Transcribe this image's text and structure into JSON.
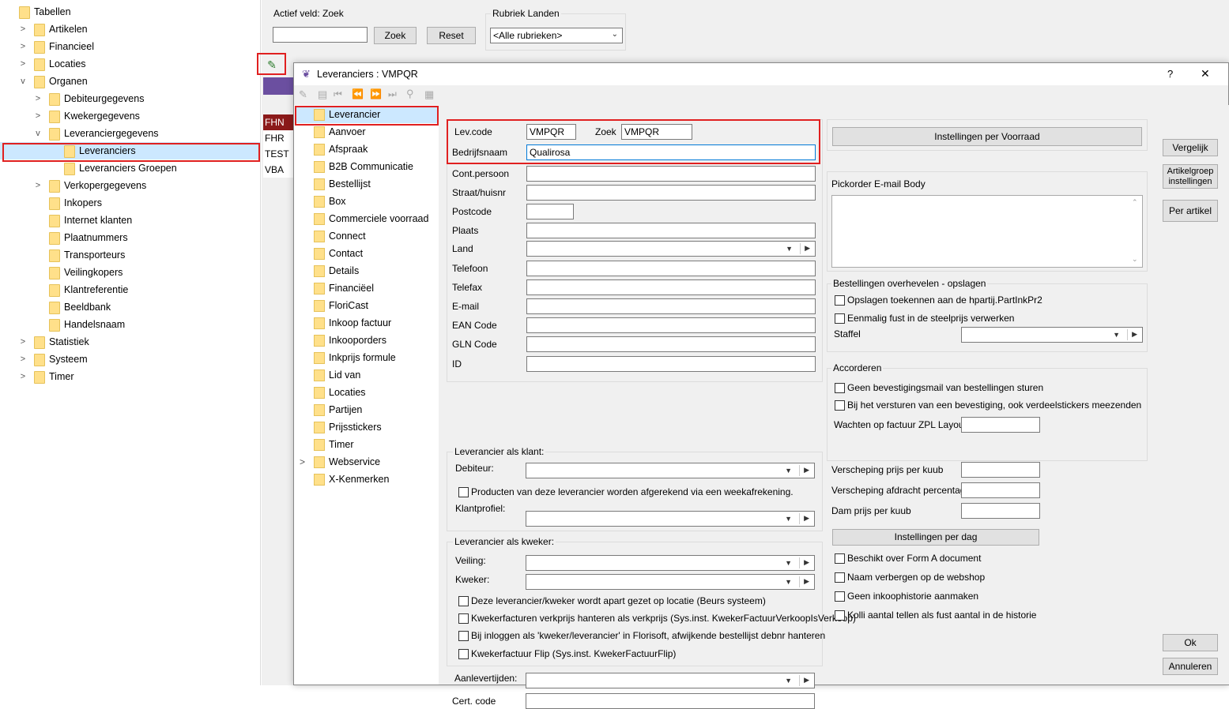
{
  "tree": {
    "items": [
      {
        "label": "Tabellen",
        "indent": 0,
        "chev": ""
      },
      {
        "label": "Artikelen",
        "indent": 1,
        "chev": ">"
      },
      {
        "label": "Financieel",
        "indent": 1,
        "chev": ">"
      },
      {
        "label": "Locaties",
        "indent": 1,
        "chev": ">"
      },
      {
        "label": "Organen",
        "indent": 1,
        "chev": "v"
      },
      {
        "label": "Debiteurgegevens",
        "indent": 2,
        "chev": ">"
      },
      {
        "label": "Kwekergegevens",
        "indent": 2,
        "chev": ">"
      },
      {
        "label": "Leveranciergegevens",
        "indent": 2,
        "chev": "v"
      },
      {
        "label": "Leveranciers",
        "indent": 3,
        "chev": ""
      },
      {
        "label": "Leveranciers Groepen",
        "indent": 3,
        "chev": ""
      },
      {
        "label": "Verkopergegevens",
        "indent": 2,
        "chev": ">"
      },
      {
        "label": "Inkopers",
        "indent": 2,
        "chev": ""
      },
      {
        "label": "Internet klanten",
        "indent": 2,
        "chev": ""
      },
      {
        "label": "Plaatnummers",
        "indent": 2,
        "chev": ""
      },
      {
        "label": "Transporteurs",
        "indent": 2,
        "chev": ""
      },
      {
        "label": "Veilingkopers",
        "indent": 2,
        "chev": ""
      },
      {
        "label": "Klantreferentie",
        "indent": 2,
        "chev": ""
      },
      {
        "label": "Beeldbank",
        "indent": 2,
        "chev": ""
      },
      {
        "label": "Handelsnaam",
        "indent": 2,
        "chev": ""
      },
      {
        "label": "Statistiek",
        "indent": 1,
        "chev": ">"
      },
      {
        "label": "Systeem",
        "indent": 1,
        "chev": ">"
      },
      {
        "label": "Timer",
        "indent": 1,
        "chev": ">"
      }
    ]
  },
  "search": {
    "group_label": "Actief veld: Zoek",
    "search_btn": "Zoek",
    "reset_btn": "Reset",
    "value": ""
  },
  "rubriek": {
    "group_label": "Rubriek Landen",
    "selected": "<Alle rubrieken>"
  },
  "grid": {
    "rows": [
      "FHN",
      "FHR",
      "TEST",
      "VBA"
    ]
  },
  "dialog": {
    "title": "Leveranciers : VMPQR",
    "help": "?",
    "close": "✕"
  },
  "nav": {
    "items": [
      "Leverancier",
      "Aanvoer",
      "Afspraak",
      "B2B Communicatie",
      "Bestellijst",
      "Box",
      "Commerciele voorraad",
      "Connect",
      "Contact",
      "Details",
      "Financiëel",
      "FloriCast",
      "Inkoop factuur",
      "Inkooporders",
      "Inkprijs formule",
      "Lid van",
      "Locaties",
      "Partijen",
      "Prijsstickers",
      "Timer",
      "Webservice",
      "X-Kenmerken"
    ]
  },
  "form": {
    "levcode_label": "Lev.code",
    "levcode": "VMPQR",
    "zoek_label": "Zoek",
    "zoek": "VMPQR",
    "bedrijfsnaam_label": "Bedrijfsnaam",
    "bedrijfsnaam": "Qualirosa",
    "fields": [
      "Cont.persoon",
      "Straat/huisnr",
      "Postcode",
      "Plaats",
      "Land",
      "Telefoon",
      "Telefax",
      "E-mail",
      "EAN Code",
      "GLN Code",
      "ID"
    ],
    "klant_group": "Leverancier als klant:",
    "debiteur_label": "Debiteur:",
    "weekafrekening": "Producten van deze leverancier worden afgerekend via een weekafrekening.",
    "klantprofiel_label": "Klantprofiel:",
    "kweker_group": "Leverancier als kweker:",
    "veiling_label": "Veiling:",
    "kweker_label": "Kweker:",
    "kweker_checks": [
      "Deze leverancier/kweker wordt apart gezet op locatie (Beurs systeem)",
      "Kwekerfacturen verkprijs hanteren als verkprijs (Sys.inst. KwekerFactuurVerkoopIsVerkoop)",
      "Bij inloggen als 'kweker/leverancier' in Florisoft, afwijkende bestellijst debnr hanteren",
      "Kwekerfactuur Flip (Sys.inst. KwekerFactuurFlip)"
    ],
    "aanlevertijden_label": "Aanlevertijden:",
    "cert_label": "Cert. code"
  },
  "right": {
    "voorraad_btn": "Instellingen per Voorraad",
    "pickorder_label": "Pickorder E-mail Body",
    "overhevelen_group": "Bestellingen overhevelen - opslagen",
    "overhevelen_checks": [
      "Opslagen toekennen aan de hpartij.PartInkPr2",
      "Eenmalig fust in de steelprijs verwerken"
    ],
    "staffel_label": "Staffel",
    "accorderen_group": "Accorderen",
    "accorderen_checks": [
      "Geen bevestigingsmail van bestellingen sturen",
      "Bij het versturen van een bevestiging, ook verdeelstickers meezenden"
    ],
    "zpl_label": "Wachten op factuur ZPL Layout",
    "kuub_label": "Verscheping prijs per kuub",
    "afdracht_label": "Verscheping afdracht percentage",
    "dam_label": "Dam prijs per kuub",
    "dag_btn": "Instellingen per dag",
    "bottom_checks": [
      "Beschikt over Form A document",
      "Naam verbergen op de webshop",
      "Geen inkoophistorie aanmaken",
      "Kolli aantal tellen als fust aantal in de historie"
    ]
  },
  "side_buttons": {
    "vergelijk": "Vergelijk",
    "artikelgroep": "Artikelgroep instellingen",
    "per_artikel": "Per artikel",
    "ok": "Ok",
    "annuleren": "Annuleren"
  },
  "colors": {
    "highlight": "#e02020",
    "selected": "#cce8ff",
    "grid_selected": "#8b1a1a",
    "purple": "#6b4fa0"
  }
}
